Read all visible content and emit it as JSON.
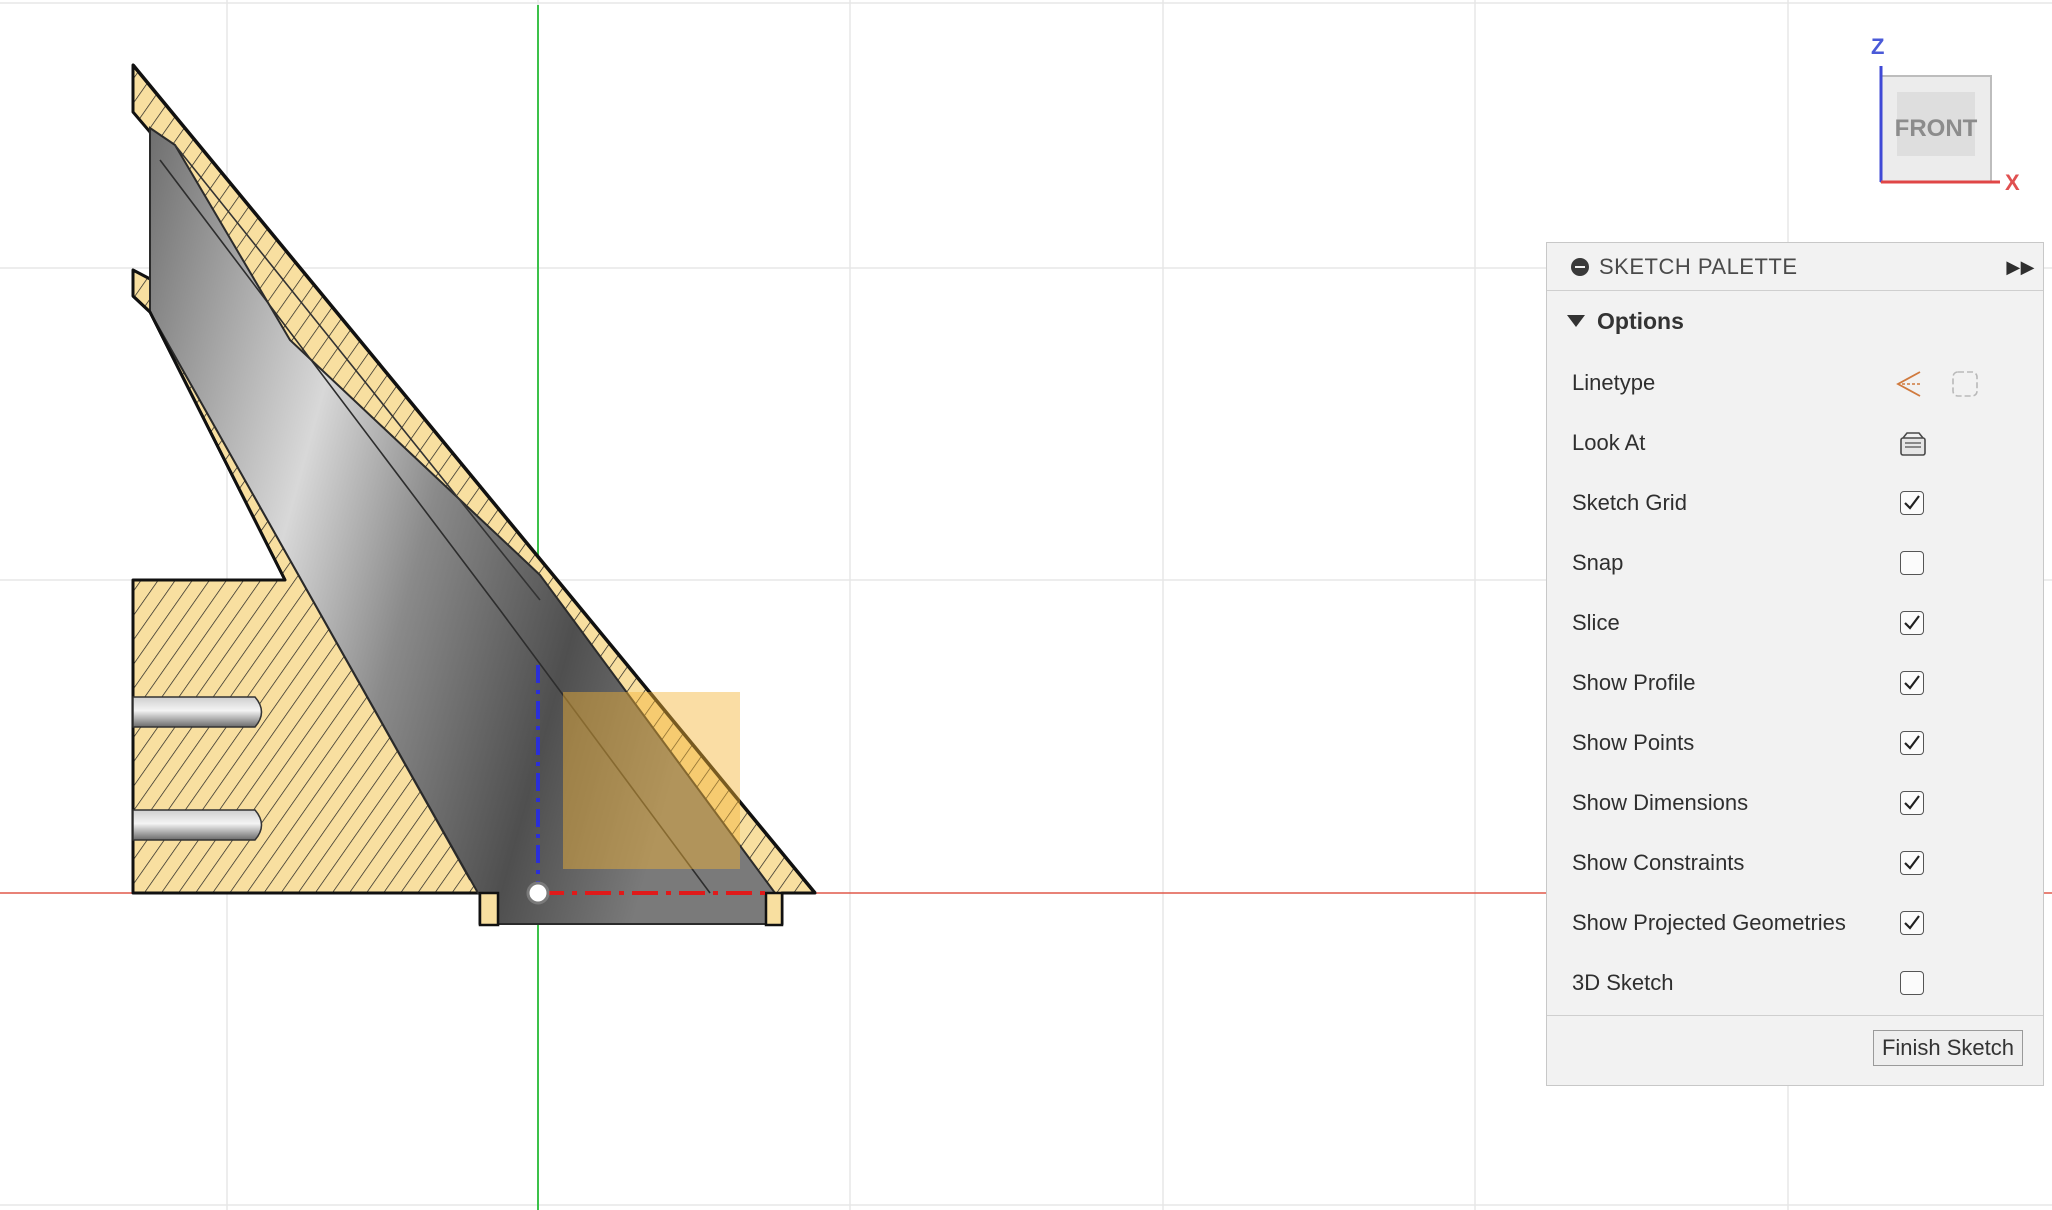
{
  "palette": {
    "title": "SKETCH PALETTE",
    "section_title": "Options",
    "rows": [
      {
        "label": "Linetype",
        "control": "linetype-icons"
      },
      {
        "label": "Look At",
        "control": "look-at-icon"
      },
      {
        "label": "Sketch Grid",
        "control": "checkbox",
        "checked": true
      },
      {
        "label": "Snap",
        "control": "checkbox",
        "checked": false
      },
      {
        "label": "Slice",
        "control": "checkbox",
        "checked": true
      },
      {
        "label": "Show Profile",
        "control": "checkbox",
        "checked": true
      },
      {
        "label": "Show Points",
        "control": "checkbox",
        "checked": true
      },
      {
        "label": "Show Dimensions",
        "control": "checkbox",
        "checked": true
      },
      {
        "label": "Show Constraints",
        "control": "checkbox",
        "checked": true
      },
      {
        "label": "Show Projected Geometries",
        "control": "checkbox",
        "checked": true
      },
      {
        "label": "3D Sketch",
        "control": "checkbox",
        "checked": false
      }
    ],
    "finish_label": "Finish Sketch"
  },
  "viewcube": {
    "face": "FRONT",
    "axis_z": "Z",
    "axis_x": "X"
  },
  "colors": {
    "part_fill": "#f8dfa0",
    "hatch": "#1e1e1e",
    "axis_x": "#e0584a",
    "axis_y": "#3cc14a",
    "axis_z_marker": "#2a2fd8",
    "annotation_arrow": "#e85448",
    "grid": "#e7e7e7"
  },
  "icons": [
    "minus-circle-icon",
    "double-chevron-right-icon",
    "triangle-down-icon",
    "linetype-construction-icon",
    "linetype-centerline-icon",
    "look-at-icon",
    "checkmark-icon",
    "red-arrow-icon"
  ]
}
